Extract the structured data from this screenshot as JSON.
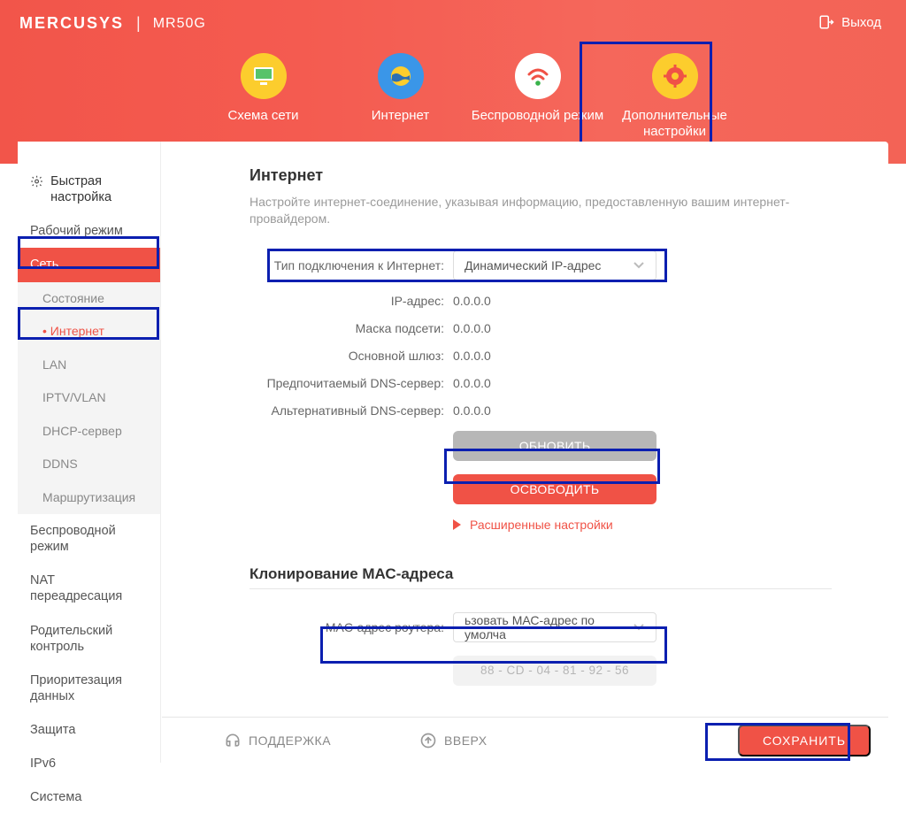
{
  "brand": {
    "logo": "MERCUSYS",
    "model": "MR50G"
  },
  "logout": "Выход",
  "nav": {
    "scheme": "Схема сети",
    "internet": "Интернет",
    "wireless": "Беспроводной режим",
    "advanced": "Дополнительные настройки"
  },
  "sidebar": {
    "quick": "Быстрая настройка",
    "mode": "Рабочий режим",
    "network": "Сеть",
    "subs": {
      "status": "Состояние",
      "internet": "Интернет",
      "lan": "LAN",
      "iptv": "IPTV/VLAN",
      "dhcp": "DHCP-сервер",
      "ddns": "DDNS",
      "routing": "Маршрутизация"
    },
    "wireless": "Беспроводной режим",
    "nat": "NAT переадресация",
    "parental": "Родительский контроль",
    "qos": "Приоритезация данных",
    "security": "Защита",
    "ipv6": "IPv6",
    "system": "Система"
  },
  "internet": {
    "title": "Интернет",
    "sub": "Настройте интернет-соединение, указывая информацию, предоставленную вашим интернет-провайдером.",
    "conn_label": "Тип подключения к Интернет:",
    "conn_value": "Динамический IP-адрес",
    "ip_label": "IP-адрес:",
    "ip_val": "0.0.0.0",
    "mask_label": "Маска подсети:",
    "mask_val": "0.0.0.0",
    "gw_label": "Основной шлюз:",
    "gw_val": "0.0.0.0",
    "dns1_label": "Предпочитаемый DNS-сервер:",
    "dns1_val": "0.0.0.0",
    "dns2_label": "Альтернативный DNS-сервер:",
    "dns2_val": "0.0.0.0",
    "refresh": "ОБНОВИТЬ",
    "release": "ОСВОБОДИТЬ",
    "advanced_link": "Расширенные настройки"
  },
  "mac": {
    "title": "Клонирование МАС-адреса",
    "label": "MAC-адрес роутера:",
    "select_value": "ьзовать МАС-адрес по умолча",
    "address": "88   -   CD   -   04   -   81   -   92   -   56"
  },
  "footer": {
    "support": "ПОДДЕРЖКА",
    "up": "ВВЕРХ",
    "save": "СОХРАНИТЬ"
  }
}
